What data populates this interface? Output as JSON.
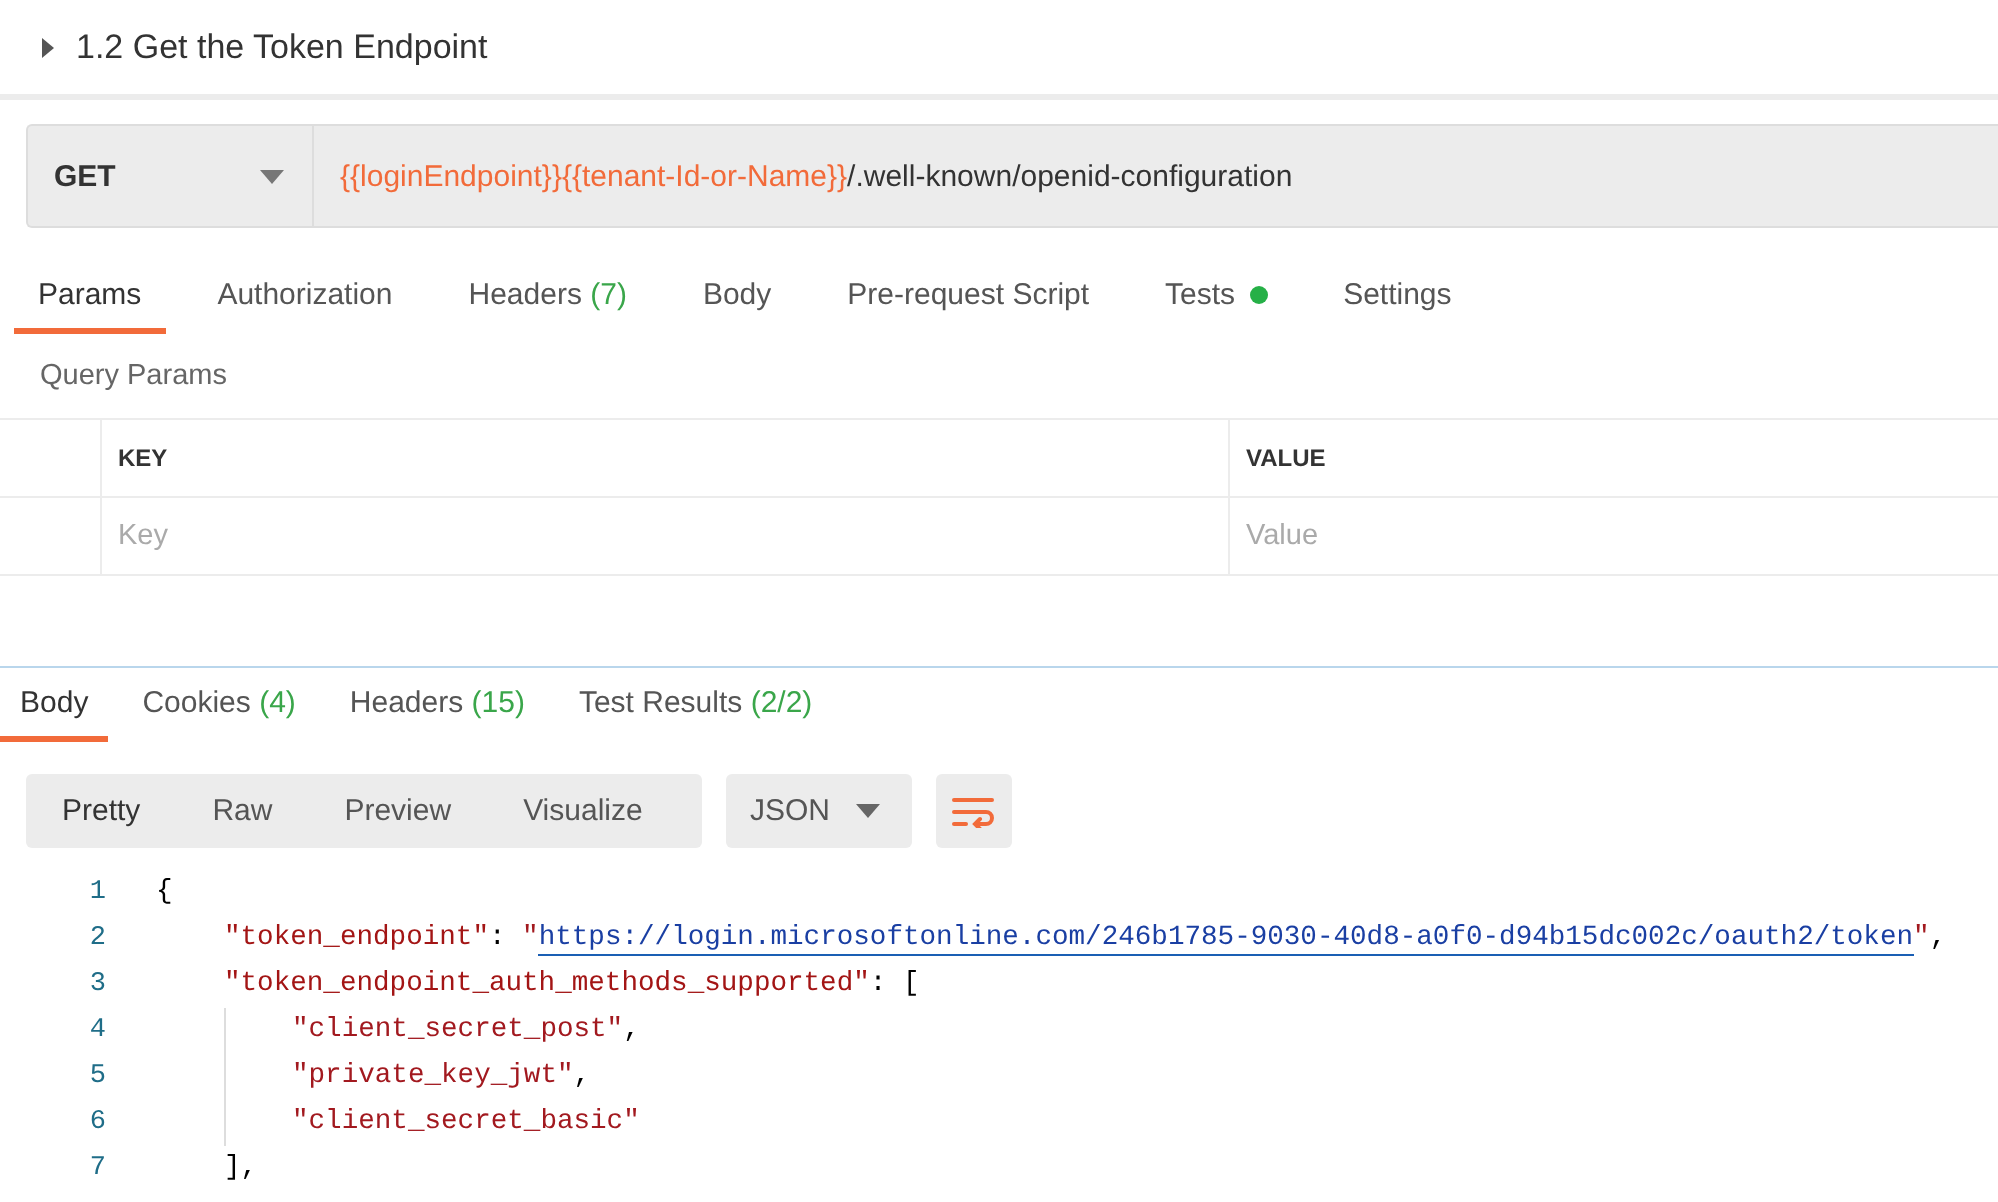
{
  "request_title": {
    "expanded": false,
    "text": "1.2 Get the Token Endpoint"
  },
  "url_bar": {
    "method": "GET",
    "url_parts": [
      {
        "text": "{{loginEndpoint}}",
        "kind": "variable"
      },
      {
        "text": "{{tenant-Id-or-Name}}",
        "kind": "variable"
      },
      {
        "text": "/.well-known/openid-configuration",
        "kind": "plain"
      }
    ]
  },
  "request_tabs": [
    {
      "label": "Params",
      "indicator": false,
      "selected": true
    },
    {
      "label": "Authorization",
      "indicator": false,
      "selected": false
    },
    {
      "label": "Headers",
      "count": "(7)",
      "indicator": false,
      "selected": false
    },
    {
      "label": "Body",
      "indicator": false,
      "selected": false
    },
    {
      "label": "Pre-request Script",
      "indicator": false,
      "selected": false
    },
    {
      "label": "Tests",
      "indicator": true,
      "selected": false
    },
    {
      "label": "Settings",
      "indicator": false,
      "selected": false
    }
  ],
  "query_params": {
    "title": "Query Params",
    "columns": [
      "KEY",
      "VALUE"
    ],
    "placeholders": [
      "Key",
      "Value"
    ]
  },
  "response_tabs": [
    {
      "label": "Body",
      "selected": true
    },
    {
      "label": "Cookies",
      "count": "(4)",
      "selected": false
    },
    {
      "label": "Headers",
      "count": "(15)",
      "selected": false
    },
    {
      "label": "Test Results",
      "count": "(2/2)",
      "selected": false
    }
  ],
  "view_modes": [
    {
      "label": "Pretty",
      "selected": true
    },
    {
      "label": "Raw",
      "selected": false
    },
    {
      "label": "Preview",
      "selected": false
    },
    {
      "label": "Visualize",
      "selected": false
    }
  ],
  "format_select": "JSON",
  "code_lines": [
    {
      "number": "1",
      "tokens": [
        {
          "text": "{",
          "kind": "punct"
        }
      ],
      "children": [
        {
          "number": "2",
          "tokens": [
            {
              "text": "\"token_endpoint\"",
              "kind": "key"
            },
            {
              "text": ": ",
              "kind": "punct"
            },
            {
              "text": "\"",
              "kind": "string"
            },
            {
              "text": "https://login.microsoftonline.com/246b1785-9030-40d8-a0f0-d94b15dc002c/oauth2/token",
              "kind": "link"
            },
            {
              "text": "\"",
              "kind": "string"
            },
            {
              "text": ",",
              "kind": "punct"
            }
          ]
        },
        {
          "number": "3",
          "tokens": [
            {
              "text": "\"token_endpoint_auth_methods_supported\"",
              "kind": "key"
            },
            {
              "text": ": [",
              "kind": "punct"
            }
          ],
          "children": [
            {
              "number": "4",
              "tokens": [
                {
                  "text": "\"client_secret_post\"",
                  "kind": "string"
                },
                {
                  "text": ",",
                  "kind": "punct"
                }
              ]
            },
            {
              "number": "5",
              "tokens": [
                {
                  "text": "\"private_key_jwt\"",
                  "kind": "string"
                },
                {
                  "text": ",",
                  "kind": "punct"
                }
              ]
            },
            {
              "number": "6",
              "tokens": [
                {
                  "text": "\"client_secret_basic\"",
                  "kind": "string"
                }
              ]
            }
          ]
        },
        {
          "number": "7",
          "tokens": [
            {
              "text": "],",
              "kind": "punct"
            }
          ]
        }
      ]
    }
  ]
}
